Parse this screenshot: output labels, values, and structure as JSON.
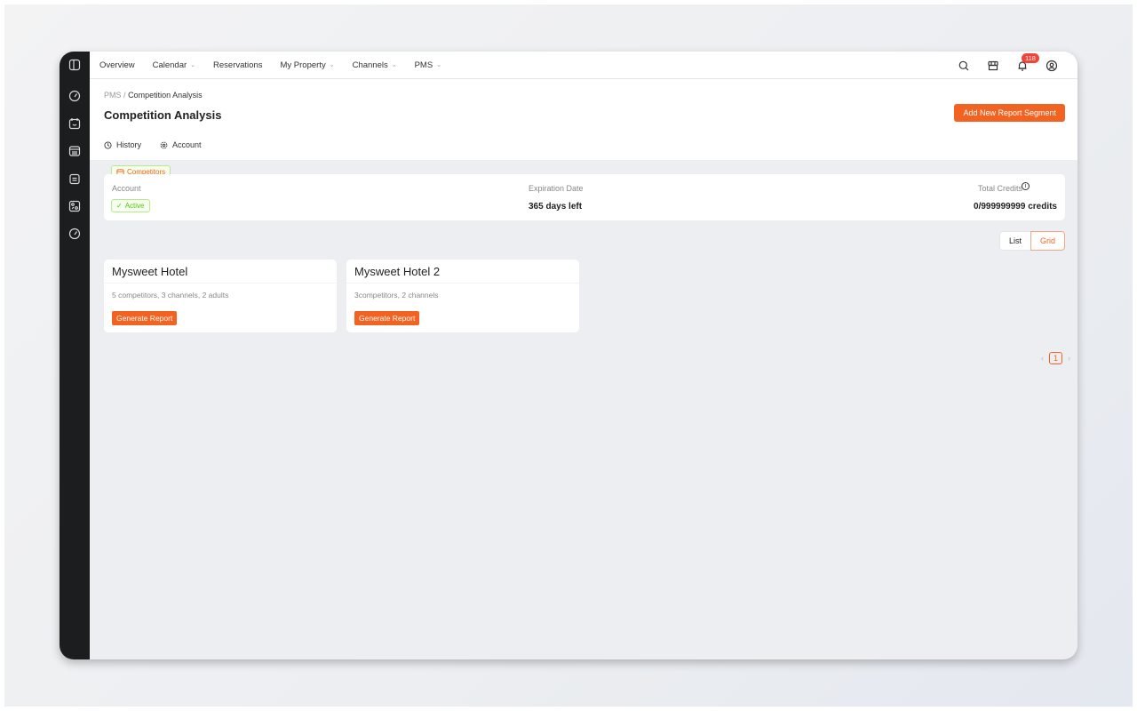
{
  "nav": {
    "items": [
      {
        "label": "Overview",
        "dropdown": false
      },
      {
        "label": "Calendar",
        "dropdown": true
      },
      {
        "label": "Reservations",
        "dropdown": false
      },
      {
        "label": "My Property",
        "dropdown": true
      },
      {
        "label": "Channels",
        "dropdown": true
      },
      {
        "label": "PMS",
        "dropdown": true
      }
    ],
    "notification_count": "118"
  },
  "breadcrumb": {
    "parent": "PMS",
    "sep": "/",
    "current": "Competition Analysis"
  },
  "page": {
    "title": "Competition Analysis",
    "add_button": "Add New Report Segment"
  },
  "tabs": [
    {
      "label": "Competitors",
      "active": true
    },
    {
      "label": "History"
    },
    {
      "label": "Account"
    }
  ],
  "account": {
    "label": "Account",
    "status": "Active",
    "exp_label": "Expiration Date",
    "exp_value": "365 days left",
    "credits_label": "Total Credits",
    "credits_value": "0/999999999 credits"
  },
  "view": {
    "list": "List",
    "grid": "Grid",
    "selected": "Grid"
  },
  "cards": [
    {
      "name": "Mysweet Hotel",
      "desc": "5 competitors, 3 channels, 2 adults",
      "button": "Generate Report"
    },
    {
      "name": "Mysweet Hotel 2",
      "desc": "3competitors, 2 channels",
      "button": "Generate Report"
    }
  ],
  "pagination": {
    "current": "1"
  },
  "colors": {
    "accent": "#f26322",
    "sidebar": "#1c1d1f",
    "success": "#52c41a"
  }
}
